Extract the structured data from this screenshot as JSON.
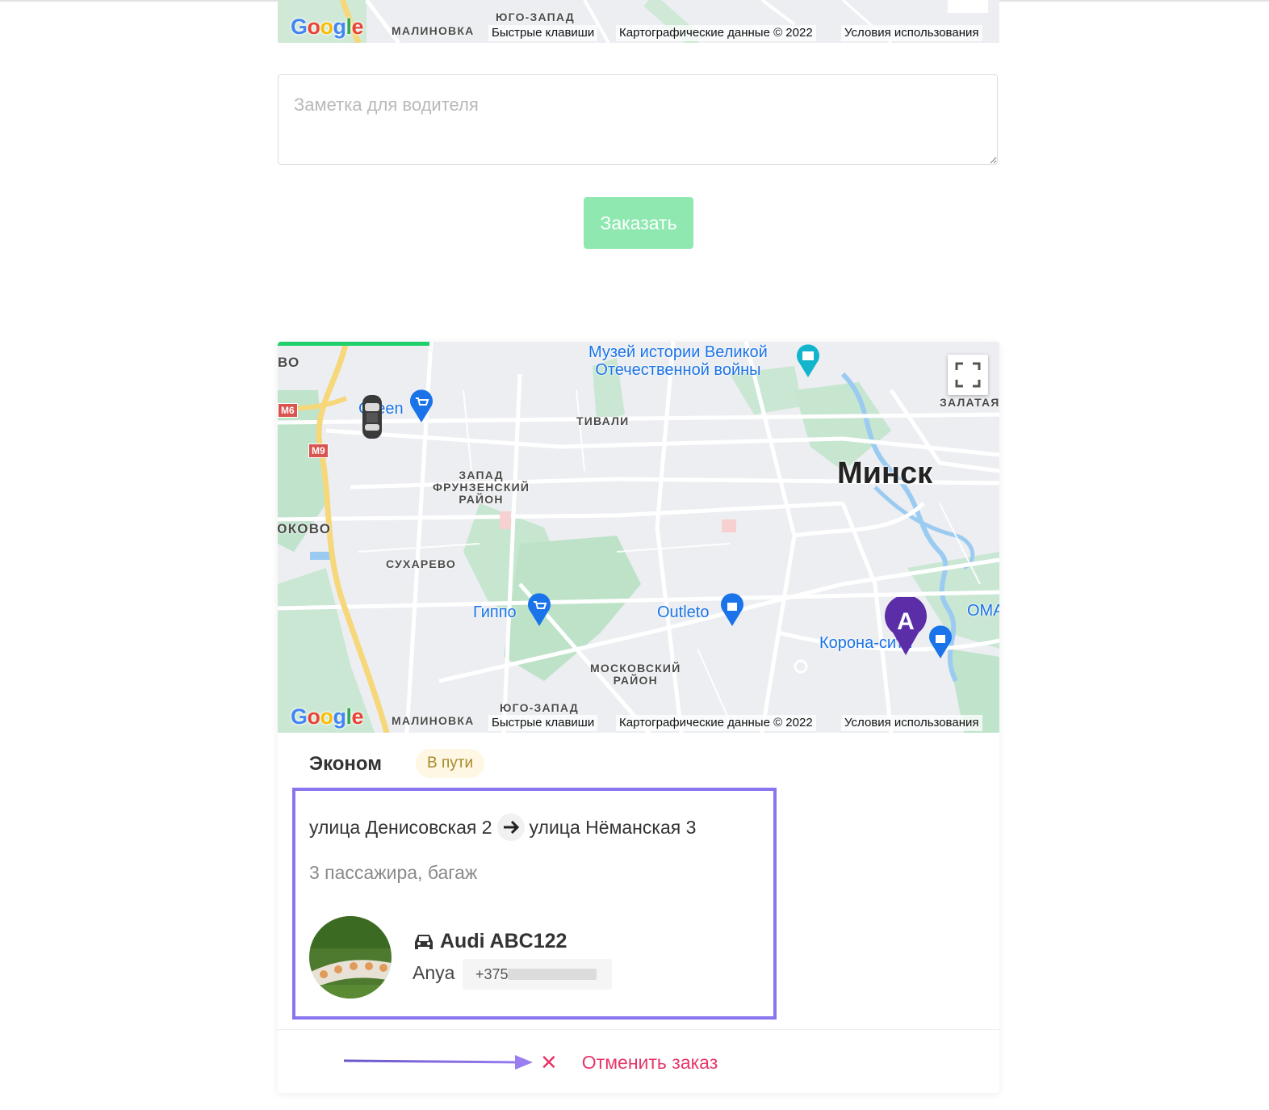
{
  "map": {
    "google_logo": "Google",
    "footer_kbd": "Быстрые клавиши",
    "footer_data": "Картографические данные © 2022",
    "footer_terms": "Условия использования",
    "labels": {
      "yugo_zapad": "ЮГО-ЗАПАД",
      "malinovka": "МАЛИНОВКА",
      "tivali": "ТИВАЛИ",
      "zapad": "ЗАПАД",
      "frunzensky": "ФРУНЗЕНСКИЙ",
      "rayon": "РАЙОН",
      "sukharevo": "СУХАРЕВО",
      "moskovsky": "МОСКОВСКИЙ",
      "zalataya": "ЗАЛАТАЯ",
      "okovo": "ЮКОВО",
      "vo": "ВО",
      "minsk": "Минск",
      "m6": "M6",
      "m9": "M9"
    },
    "pois": {
      "museum_line1": "Музей истории Великой",
      "museum_line2": "Отечественной войны",
      "green": "Green",
      "gippo": "Гиппо",
      "outleto": "Outleto",
      "korona": "Корона-сити",
      "oma": "ОМА"
    },
    "marker_a": "A"
  },
  "form": {
    "note_placeholder": "Заметка для водителя",
    "note_value": "",
    "order_label": "Заказать"
  },
  "order": {
    "progress": 0.21,
    "tariff": "Эконом",
    "status": "В пути",
    "from": "улица Денисовская 2",
    "to": "улица Нёманская 3",
    "passengers": "3 пассажира, багаж",
    "car": "Audi ABC122",
    "driver": "Anya",
    "phone_prefix": "+375",
    "cancel_label": "Отменить заказ"
  },
  "colors": {
    "accent_green": "#1fcf6a",
    "order_button": "#8ee8b0",
    "highlight": "#8b74f0",
    "cancel": "#e6376a",
    "marker": "#5b2ea8"
  },
  "icons": {
    "arrow": "arrow-right-icon",
    "car": "car-icon",
    "cancel": "close-icon",
    "fullscreen": "fullscreen-icon"
  }
}
